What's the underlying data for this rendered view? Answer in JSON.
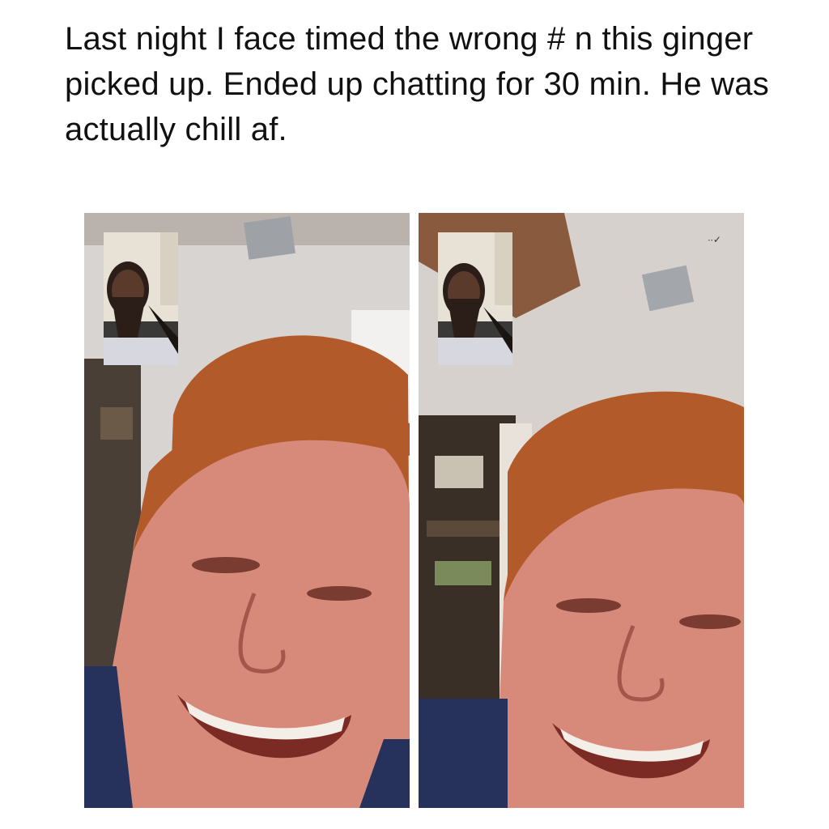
{
  "post": {
    "text": "Last night I face timed the wrong # n this ginger picked up. Ended up chatting for 30 min. He was actually chill af."
  },
  "screenshots": [
    {
      "label": "facetime-screenshot-1"
    },
    {
      "label": "facetime-screenshot-2"
    }
  ],
  "colors": {
    "text": "#111111",
    "ceiling": "#d9d6d3",
    "hair": "#b35a2a",
    "skin": "#d88a7a",
    "shirt": "#26325c",
    "teeth": "#f3efe8"
  }
}
